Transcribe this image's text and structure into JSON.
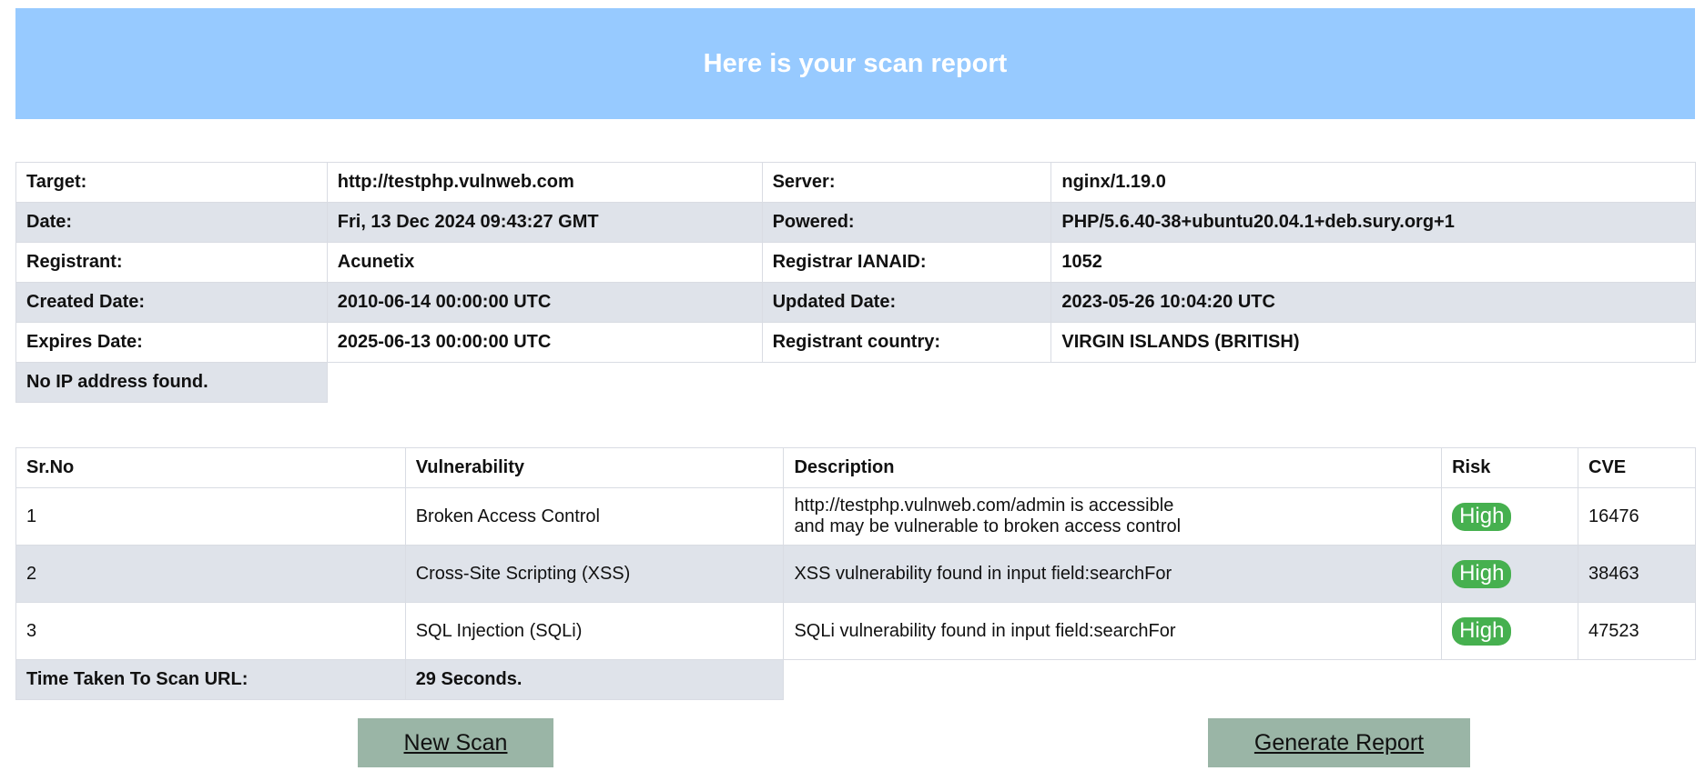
{
  "header": {
    "title": "Here is your scan report"
  },
  "info": {
    "target_label": "Target:",
    "target_value": "http://testphp.vulnweb.com",
    "server_label": "Server:",
    "server_value": "nginx/1.19.0",
    "date_label": "Date:",
    "date_value": "Fri, 13 Dec 2024 09:43:27 GMT",
    "powered_label": "Powered:",
    "powered_value": "PHP/5.6.40-38+ubuntu20.04.1+deb.sury.org+1",
    "registrant_label": "Registrant:",
    "registrant_value": "Acunetix",
    "ianaid_label": "Registrar IANAID:",
    "ianaid_value": "1052",
    "created_label": "Created Date:",
    "created_value": "2010-06-14 00:00:00 UTC",
    "updated_label": "Updated Date:",
    "updated_value": "2023-05-26 10:04:20 UTC",
    "expires_label": "Expires Date:",
    "expires_value": "2025-06-13 00:00:00 UTC",
    "country_label": "Registrant country:",
    "country_value": "VIRGIN ISLANDS (BRITISH)",
    "no_ip": "No IP address found."
  },
  "vulnerabilities": {
    "headers": [
      "Sr.No",
      "Vulnerability",
      "Description",
      "Risk",
      "CVE"
    ],
    "rows": [
      {
        "sr": "1",
        "name": "Broken Access Control",
        "description_lines": [
          "http://testphp.vulnweb.com/admin is accessible",
          "and may be vulnerable to broken access control"
        ],
        "risk": "High",
        "cve": "16476"
      },
      {
        "sr": "2",
        "name": "Cross-Site Scripting (XSS)",
        "description_lines": [
          "XSS vulnerability found in input field:searchFor"
        ],
        "risk": "High",
        "cve": "38463"
      },
      {
        "sr": "3",
        "name": "SQL Injection (SQLi)",
        "description_lines": [
          "SQLi vulnerability found in input field:searchFor"
        ],
        "risk": "High",
        "cve": "47523"
      }
    ],
    "time_label": "Time Taken To Scan URL:",
    "time_value": "29 Seconds."
  },
  "buttons": {
    "new_scan": "New Scan",
    "generate_report": "Generate Report"
  },
  "colors": {
    "banner": "#97caff",
    "risk_high": "#46b04f",
    "button": "#9ab5a6",
    "row_shade": "#dfe3ea"
  }
}
